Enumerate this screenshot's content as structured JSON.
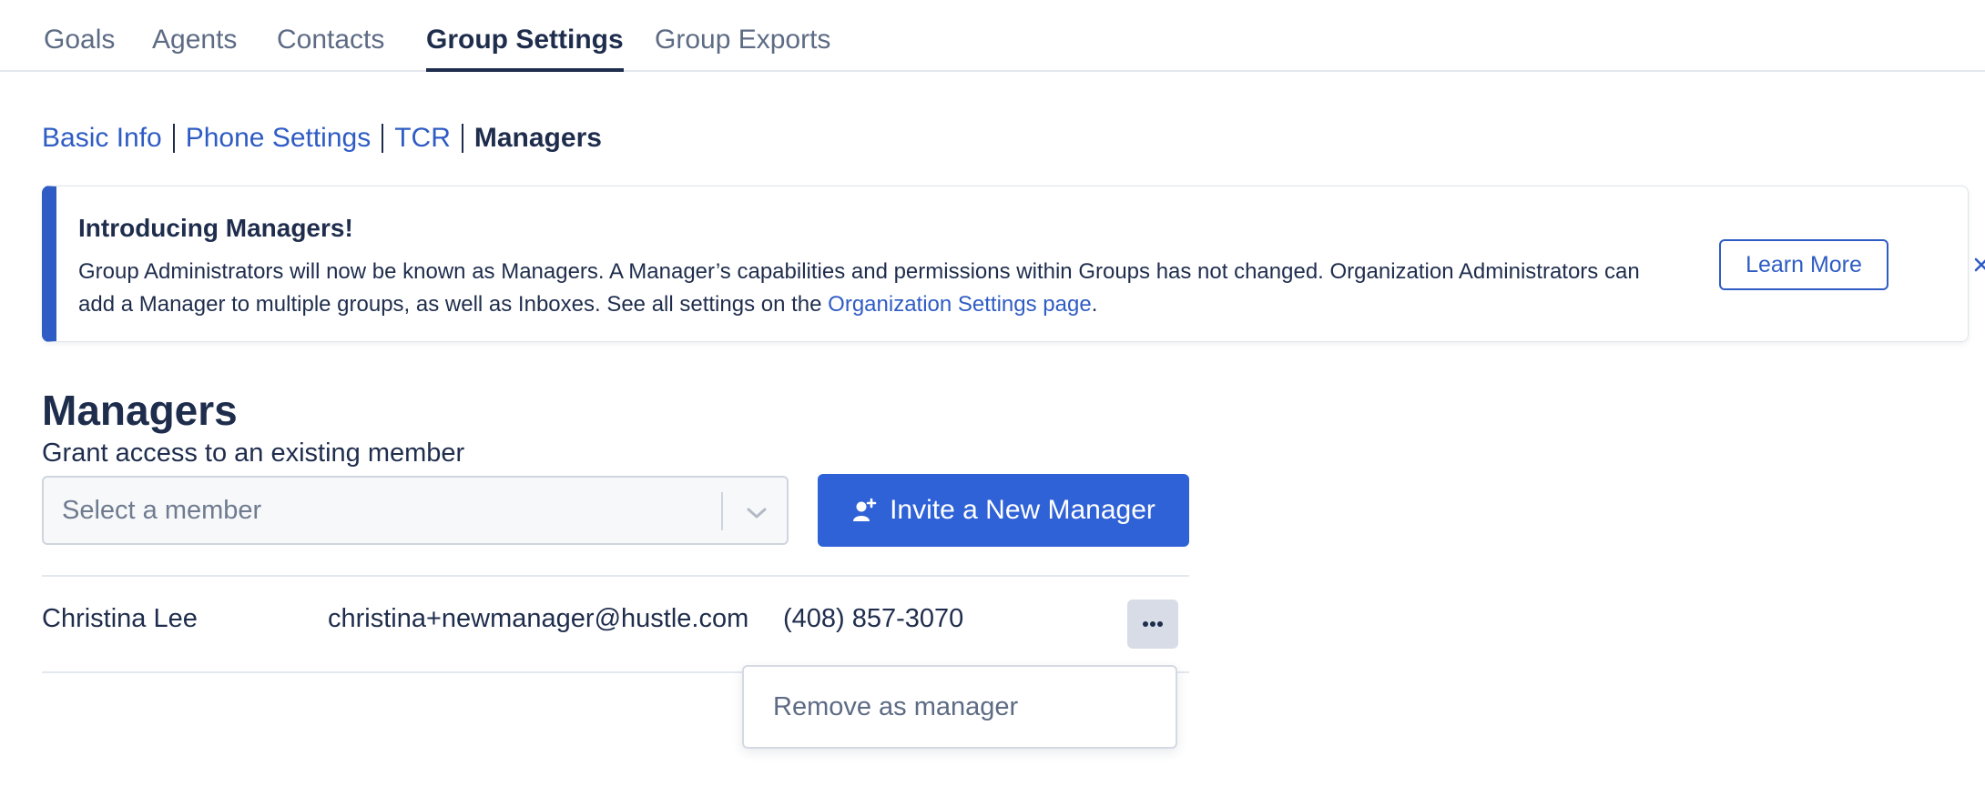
{
  "top_tabs": [
    {
      "label": "Goals"
    },
    {
      "label": "Agents"
    },
    {
      "label": "Contacts"
    },
    {
      "label": "Group Settings",
      "active": true
    },
    {
      "label": "Group Exports"
    }
  ],
  "sub_nav": {
    "links": [
      "Basic Info",
      "Phone Settings",
      "TCR"
    ],
    "current": "Managers"
  },
  "banner": {
    "title": "Introducing Managers!",
    "text": "Group Administrators will now be known as Managers. A Manager’s capabilities and permissions within Groups has not changed. Organization Administrators can add a Manager to multiple groups, as well as Inboxes. See all settings on the ",
    "link_text": "Organization Settings page",
    "text_end": ".",
    "learn_more_label": "Learn More",
    "close_glyph": "×",
    "accent_color": "#2f5cc4"
  },
  "managers": {
    "title": "Managers",
    "subtitle": "Grant access to an existing member",
    "select_placeholder": "Select a member",
    "invite_label": "Invite a New Manager",
    "rows": [
      {
        "name": "Christina Lee",
        "email": "christina+newmanager@hustle.com",
        "phone": "(408) 857-3070"
      }
    ],
    "row_menu": {
      "items": [
        "Remove as manager"
      ]
    }
  }
}
